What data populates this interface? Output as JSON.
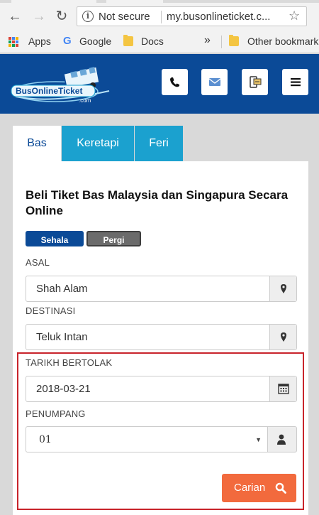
{
  "browser": {
    "security_label": "Not secure",
    "url": "my.busonlineticket.c...",
    "bookmarks": {
      "apps": "Apps",
      "google": "Google",
      "docs": "Docs",
      "overflow": "»",
      "other": "Other bookmark"
    },
    "icons": {
      "back": "back-arrow-icon",
      "forward": "forward-arrow-icon",
      "reload": "reload-icon",
      "info": "info-icon",
      "star": "star-icon"
    }
  },
  "header": {
    "logo_text": "BusOnlineTicket",
    "logo_sub": ".com",
    "buttons": [
      "phone-icon",
      "envelope-icon",
      "mobile-ticket-icon",
      "hamburger-menu-icon"
    ],
    "color": "#0b4a97"
  },
  "tabs": [
    {
      "label": "Bas",
      "active": true
    },
    {
      "label": "Keretapi",
      "active": false
    },
    {
      "label": "Feri",
      "active": false
    }
  ],
  "form": {
    "title": "Beli Tiket Bas Malaysia dan Singapura Secara Online",
    "trip_types": [
      "Sehala",
      "Pergi Balik"
    ],
    "selected_trip": "Sehala",
    "origin": {
      "label": "ASAL",
      "value": "Shah Alam",
      "icon": "map-marker-icon"
    },
    "destination": {
      "label": "DESTINASI",
      "value": "Teluk Intan",
      "icon": "map-marker-icon"
    },
    "departure": {
      "label": "TARIKH BERTOLAK",
      "value": "2018-03-21",
      "icon": "calendar-icon"
    },
    "passengers": {
      "label": "PENUMPANG",
      "value": "01",
      "icon": "user-icon"
    },
    "search_label": "Carian",
    "accent": "#f26a3d",
    "tab_color": "#1ba1cf",
    "highlight_color": "#c8242b"
  }
}
